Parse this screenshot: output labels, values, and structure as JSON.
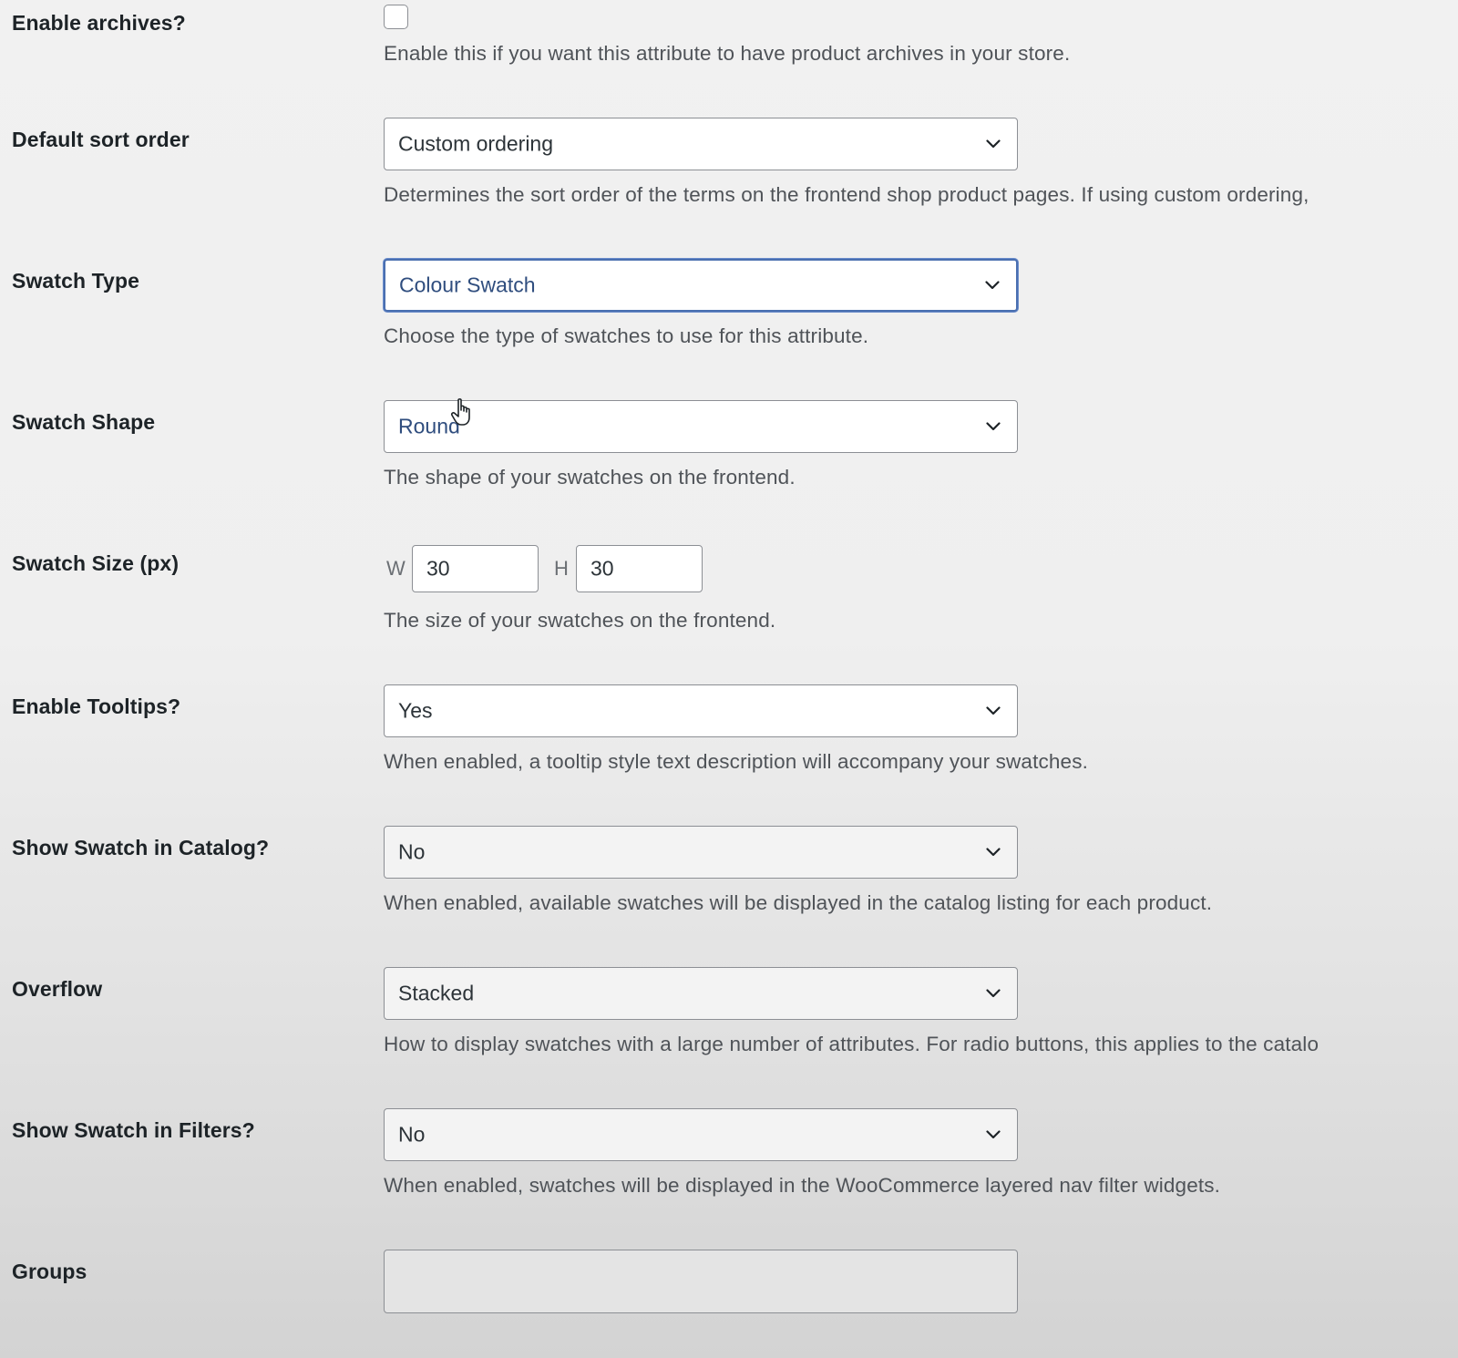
{
  "fields": {
    "enable_archives": {
      "label": "Enable archives?",
      "checked": false,
      "description": "Enable this if you want this attribute to have product archives in your store."
    },
    "default_sort_order": {
      "label": "Default sort order",
      "value": "Custom ordering",
      "description": "Determines the sort order of the terms on the frontend shop product pages. If using custom ordering,"
    },
    "swatch_type": {
      "label": "Swatch Type",
      "value": "Colour Swatch",
      "description": "Choose the type of swatches to use for this attribute."
    },
    "swatch_shape": {
      "label": "Swatch Shape",
      "value": "Round",
      "description": "The shape of your swatches on the frontend."
    },
    "swatch_size": {
      "label": "Swatch Size (px)",
      "width_prefix": "W",
      "width_value": "30",
      "height_prefix": "H",
      "height_value": "30",
      "description": "The size of your swatches on the frontend."
    },
    "enable_tooltips": {
      "label": "Enable Tooltips?",
      "value": "Yes",
      "description": "When enabled, a tooltip style text description will accompany your swatches."
    },
    "show_in_catalog": {
      "label": "Show Swatch in Catalog?",
      "value": "No",
      "description": "When enabled, available swatches will be displayed in the catalog listing for each product."
    },
    "overflow": {
      "label": "Overflow",
      "value": "Stacked",
      "description": "How to display swatches with a large number of attributes. For radio buttons, this applies to the catalo"
    },
    "show_in_filters": {
      "label": "Show Swatch in Filters?",
      "value": "No",
      "description": "When enabled, swatches will be displayed in the WooCommerce layered nav filter widgets."
    },
    "groups": {
      "label": "Groups",
      "value": ""
    }
  },
  "colors": {
    "focus_border": "#4a6fb0",
    "label_text": "#1d2327",
    "description_text": "#4f5358",
    "field_border": "#8c8f94"
  },
  "icons": {
    "select_arrow": "chevron-down-icon",
    "mouse_cursor": "hand-pointer-icon"
  }
}
